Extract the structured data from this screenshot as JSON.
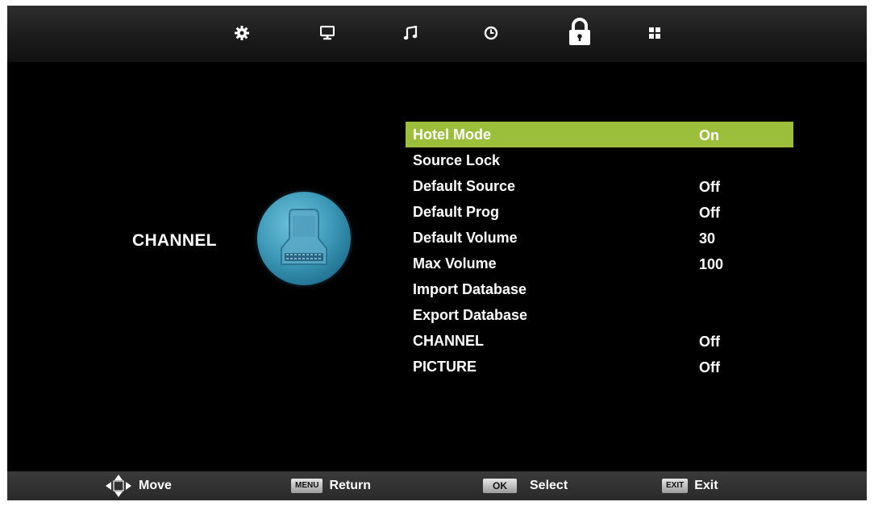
{
  "tabs": [
    {
      "name": "gear-icon",
      "active": false
    },
    {
      "name": "monitor-icon",
      "active": false
    },
    {
      "name": "music-note-icon",
      "active": false
    },
    {
      "name": "clock-icon",
      "active": false
    },
    {
      "name": "lock-icon",
      "active": true
    },
    {
      "name": "grid-icon",
      "active": false
    }
  ],
  "category": {
    "label": "CHANNEL",
    "icon": "hotel-badge-icon"
  },
  "menu": {
    "items": [
      {
        "label": "Hotel Mode",
        "value": "On"
      },
      {
        "label": "Source Lock",
        "value": ""
      },
      {
        "label": "Default Source",
        "value": "Off"
      },
      {
        "label": "Default Prog",
        "value": "Off"
      },
      {
        "label": "Default Volume",
        "value": "30"
      },
      {
        "label": "Max Volume",
        "value": "100"
      },
      {
        "label": "Import Database",
        "value": ""
      },
      {
        "label": "Export Database",
        "value": ""
      },
      {
        "label": "CHANNEL",
        "value": "Off"
      },
      {
        "label": "PICTURE",
        "value": "Off"
      }
    ],
    "selected_index": 0
  },
  "hints": {
    "move": {
      "label": "Move",
      "icon": "arrows-icon"
    },
    "return": {
      "key": "MENU",
      "label": "Return"
    },
    "select": {
      "key": "OK",
      "label": "Select"
    },
    "exit": {
      "key": "EXIT",
      "label": "Exit"
    }
  },
  "colors": {
    "highlight": "#9bbf3b",
    "background": "#000000",
    "text": "#ffffff"
  }
}
